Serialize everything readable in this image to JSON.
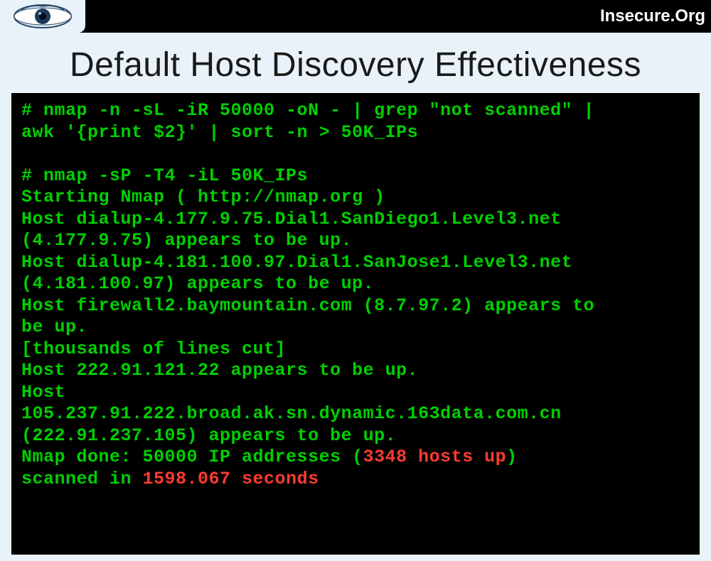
{
  "header": {
    "brand": "Insecure.Org"
  },
  "slide": {
    "title": "Default Host Discovery Effectiveness"
  },
  "terminal": {
    "cmd1_l1": "# nmap -n -sL -iR 50000 -oN - | grep \"not scanned\" |",
    "cmd1_l2": "awk '{print $2}' | sort -n > 50K_IPs",
    "blank": "",
    "cmd2": "# nmap -sP -T4 -iL 50K_IPs",
    "starting": "Starting Nmap ( http://nmap.org )",
    "host1_l1": "Host dialup-4.177.9.75.Dial1.SanDiego1.Level3.net",
    "host1_l2": "(4.177.9.75) appears to be up.",
    "host2_l1": "Host dialup-4.181.100.97.Dial1.SanJose1.Level3.net",
    "host2_l2": "(4.181.100.97) appears to be up.",
    "host3_l1": "Host firewall2.baymountain.com (8.7.97.2) appears to",
    "host3_l2": "be up.",
    "cut_note": "[thousands of lines cut]",
    "host4": "Host 222.91.121.22 appears to be up.",
    "host5_l1": "Host",
    "host5_l2": "105.237.91.222.broad.ak.sn.dynamic.163data.com.cn",
    "host5_l3": "(222.91.237.105) appears to be up.",
    "done_prefix": "Nmap done: 50000 IP addresses (",
    "done_red": "3348 hosts up",
    "done_suffix": ")",
    "scanned_prefix": "scanned in ",
    "scanned_red": "1598.067 seconds"
  }
}
